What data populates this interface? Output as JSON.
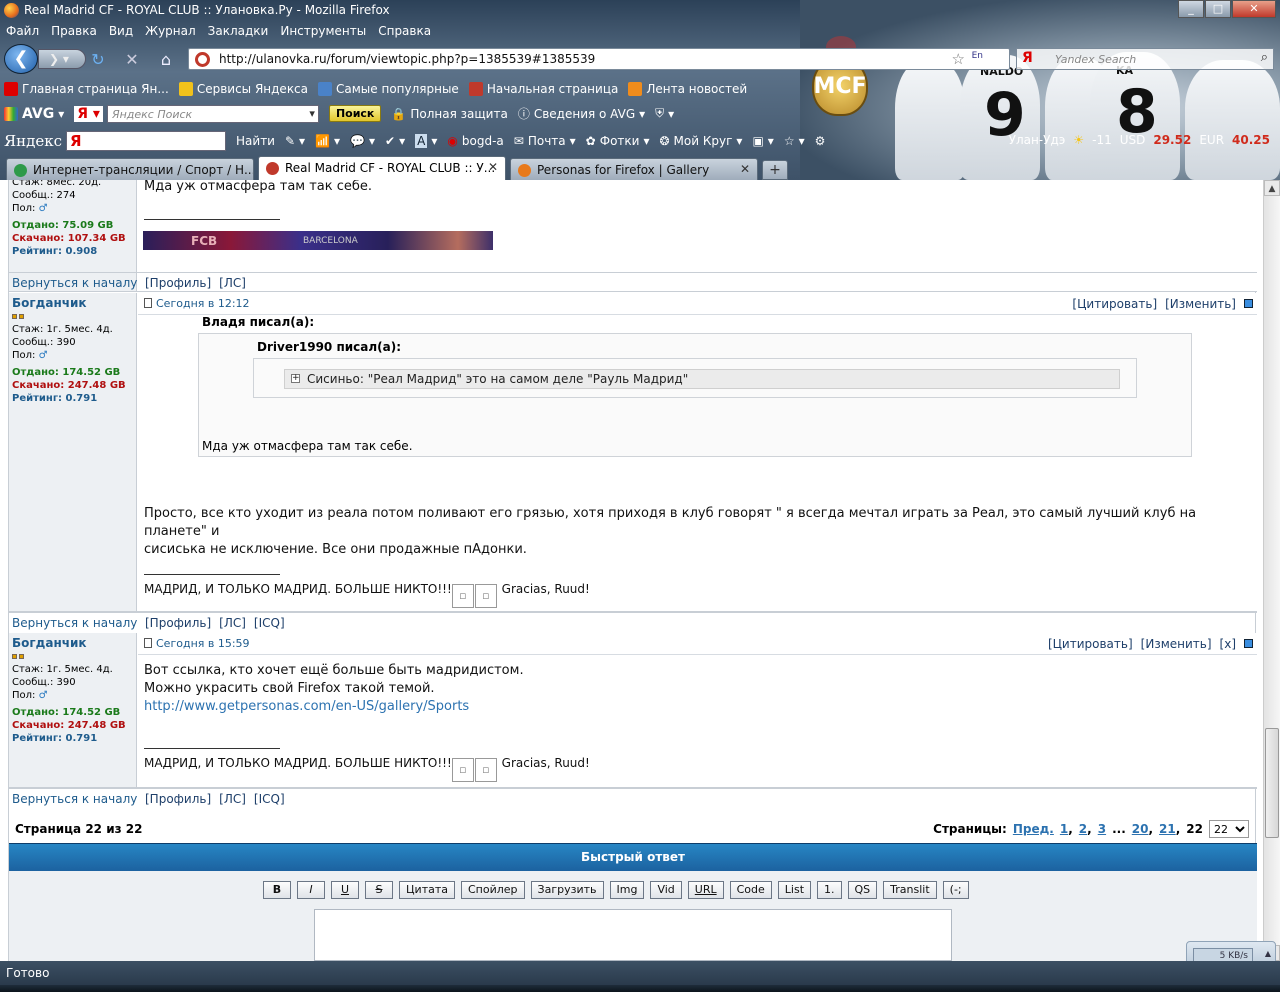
{
  "window": {
    "title": "Real Madrid CF - ROYAL CLUB :: Улановка.Ру - Mozilla Firefox"
  },
  "menu": [
    "Файл",
    "Правка",
    "Вид",
    "Журнал",
    "Закладки",
    "Инструменты",
    "Справка"
  ],
  "nav": {
    "url": "http://ulanovka.ru/forum/viewtopic.php?p=1385539#1385539",
    "search_placeholder": "Yandex Search",
    "lang": "En"
  },
  "bookmarks": [
    {
      "label": "Главная страница Ян...",
      "color": "#d00"
    },
    {
      "label": "Сервисы Яндекса",
      "color": "#f2c21b"
    },
    {
      "label": "Самые популярные",
      "color": "#4a82c8"
    },
    {
      "label": "Начальная страница",
      "color": "#c0392b"
    },
    {
      "label": "Лента новостей",
      "color": "#f08c1c"
    }
  ],
  "avgbar": {
    "logo": "AVG",
    "placeholder": "Яндекс Поиск",
    "search_button": "Поиск",
    "protection": "Полная защита",
    "info": "Сведения о AVG"
  },
  "yabar": {
    "logo": "Яндекс",
    "find": "Найти",
    "user": "bogd-a",
    "mail": "Почта",
    "photos": "Фотки",
    "circle": "Мой Круг"
  },
  "weather": {
    "city": "Улан-Удэ",
    "temp": "-11",
    "usd_label": "USD",
    "usd": "29.52",
    "eur_label": "EUR",
    "eur": "40.25"
  },
  "banner": {
    "num1": "9",
    "num2": "8",
    "name1": "NALDO",
    "name2": "KA"
  },
  "tabs": [
    {
      "label": "Интернет-трансляции / Спорт / Н...",
      "color": "#2e9a4a"
    },
    {
      "label": "Real Madrid CF - ROYAL CLUB :: У...",
      "color": "#c0392b"
    },
    {
      "label": "Personas for Firefox | Gallery",
      "color": "#e87a1c"
    }
  ],
  "post0": {
    "side": {
      "stazh": "Стаж: 8мес. 20д.",
      "msgs_label": "Сообщ.:",
      "msgs": "274",
      "sex": "Пол:",
      "up_label": "Отдано:",
      "up": "75.09 GB",
      "down_label": "Скачано:",
      "down": "107.34 GB",
      "rating_label": "Рейтинг:",
      "rating": "0.908"
    },
    "text": "Мда уж отмасфера там так себе.",
    "banner_text": "FCB",
    "banner_text2": "BARCELONA"
  },
  "post1": {
    "user": "Богданчик",
    "side": {
      "stazh": "Стаж: 1г. 5мес. 4д.",
      "msgs_label": "Сообщ.:",
      "msgs": "390",
      "sex": "Пол:",
      "up_label": "Отдано:",
      "up": "174.52 GB",
      "down_label": "Скачано:",
      "down": "247.48 GB",
      "rating_label": "Рейтинг:",
      "rating": "0.791"
    },
    "time": "Сегодня в 12:12",
    "quote_author": "Владя писал(а):",
    "inner_quote_author": "Driver1990 писал(а):",
    "spoiler": "Сисиньо: \"Реал Мадрид\" это на самом деле \"Рауль Мадрид\"",
    "quote_text": "Мда уж отмасфера там так себе.",
    "text_line1": "Просто, все кто уходит из реала потом поливают его грязью, хотя приходя в клуб говорят \" я всегда мечтал играть за Реал, это самый лучший клуб на планете\" и",
    "text_line2": "сисиська не исключение. Все они продажные пАдонки.",
    "signature": "МАДРИД, И ТОЛЬКО МАДРИД. БОЛЬШЕ НИКТО!!!",
    "signature_tail": "Gracias, Ruud!"
  },
  "post2": {
    "user": "Богданчик",
    "side": {
      "stazh": "Стаж: 1г. 5мес. 4д.",
      "msgs_label": "Сообщ.:",
      "msgs": "390",
      "sex": "Пол:",
      "up_label": "Отдано:",
      "up": "174.52 GB",
      "down_label": "Скачано:",
      "down": "247.48 GB",
      "rating_label": "Рейтинг:",
      "rating": "0.791"
    },
    "time": "Сегодня в 15:59",
    "line1": "Вот ссылка, кто хочет ещё больше быть мадридистом.",
    "line2": "Можно украсить свой Firefox такой темой.",
    "link": "http://www.getpersonas.com/en-US/gallery/Sports",
    "signature": "МАДРИД, И ТОЛЬКО МАДРИД. БОЛЬШЕ НИКТО!!!",
    "signature_tail": "Gracias, Ruud!"
  },
  "actions": {
    "quote": "[Цитировать]",
    "edit": "[Изменить]",
    "delete": "[x]"
  },
  "footer": {
    "back": "Вернуться к началу",
    "profile": "[Профиль]",
    "pm": "[ЛС]",
    "icq": "[ICQ]"
  },
  "pager": {
    "label": "Страница 22 из 22",
    "pages_label": "Страницы:",
    "prev": "Пред.",
    "p1": "1",
    "p2": "2",
    "p3": "3",
    "dots": "...",
    "p20": "20",
    "p21": "21",
    "current": "22",
    "select": "22"
  },
  "quick_reply": "Быстрый ответ",
  "bbcodes": [
    "B",
    "I",
    "U",
    "S",
    "Цитата",
    "Спойлер",
    "Загрузить",
    "Img",
    "Vid",
    "URL",
    "Code",
    "List",
    "1.",
    "QS",
    "Translit",
    "(-;"
  ],
  "status": "Готово",
  "speed": "5 KB/s"
}
